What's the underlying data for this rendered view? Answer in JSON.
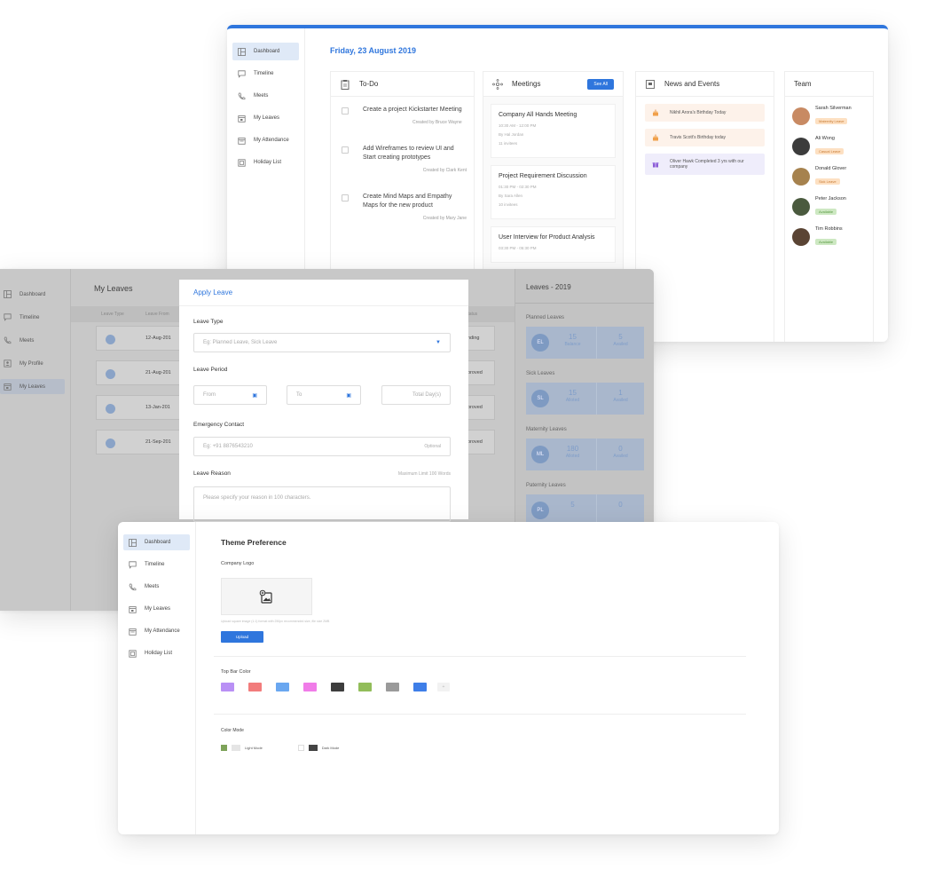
{
  "dashboard": {
    "nav": [
      {
        "label": "Dashboard",
        "icon": "dashboard-icon",
        "active": true
      },
      {
        "label": "Timeline",
        "icon": "chat-icon",
        "active": false
      },
      {
        "label": "Meets",
        "icon": "phone-icon",
        "active": false
      },
      {
        "label": "My Leaves",
        "icon": "calendar-icon",
        "active": false
      },
      {
        "label": "My Attendance",
        "icon": "calendar-check-icon",
        "active": false
      },
      {
        "label": "Holiday List",
        "icon": "holiday-icon",
        "active": false
      }
    ],
    "date": "Friday, 23 August 2019",
    "todo": {
      "title": "To-Do",
      "items": [
        {
          "text": "Create a project Kickstarter Meeting",
          "by": "Created by Bruce Wayne"
        },
        {
          "text": "Add Wireframes to review UI and Start creating prototypes",
          "by": "Created by Clark Kent"
        },
        {
          "text": "Create Mind Maps and Empathy Maps for the new product",
          "by": "Created by Mary Jane"
        }
      ]
    },
    "meetings": {
      "title": "Meetings",
      "see_all": "See All",
      "items": [
        {
          "title": "Company All Hands Meeting",
          "time": "10:30 AM - 12:00 PM",
          "by": "By Hal Jordan",
          "invitees": "11 invitees"
        },
        {
          "title": "Project Requirement Discussion",
          "time": "01:30 PM - 02:30 PM",
          "by": "By Sara Allen",
          "invitees": "10 invitees"
        },
        {
          "title": "User Interview for Product Analysis",
          "time": "03:30 PM - 05:30 PM",
          "by": "",
          "invitees": ""
        }
      ]
    },
    "news": {
      "title": "News and Events",
      "items": [
        {
          "text": "Nikhil Arora's Birthday Today",
          "color": "orange",
          "icon": "cake-icon"
        },
        {
          "text": "Travis Scott's Birthday today",
          "color": "orange",
          "icon": "cake-icon"
        },
        {
          "text": "Oliver Hawk Completed 3 yrs with our company",
          "color": "purple",
          "icon": "gift-icon"
        }
      ]
    },
    "team": {
      "title": "Team",
      "members": [
        {
          "name": "Sarah Silverman",
          "tag": "Maternity Leave",
          "tag_bg": "#fde0c2",
          "tag_fg": "#c77a33",
          "avatar": "#c88a63"
        },
        {
          "name": "Ali Wong",
          "tag": "Casual Leave",
          "tag_bg": "#fde0c2",
          "tag_fg": "#c77a33",
          "avatar": "#3c3c3c"
        },
        {
          "name": "Donald Glover",
          "tag": "Sick Leave",
          "tag_bg": "#fde0c2",
          "tag_fg": "#c77a33",
          "avatar": "#a6824e"
        },
        {
          "name": "Peter Jackson",
          "tag": "Available",
          "tag_bg": "#cde8c2",
          "tag_fg": "#5a9a43",
          "avatar": "#4a5a3e"
        },
        {
          "name": "Tim Robbins",
          "tag": "Available",
          "tag_bg": "#cde8c2",
          "tag_fg": "#5a9a43",
          "avatar": "#5a4434"
        }
      ]
    }
  },
  "leaves_page": {
    "nav": [
      {
        "label": "Dashboard",
        "icon": "dashboard-icon",
        "active": false
      },
      {
        "label": "Timeline",
        "icon": "chat-icon",
        "active": false
      },
      {
        "label": "Meets",
        "icon": "phone-icon",
        "active": false
      },
      {
        "label": "My Profile",
        "icon": "profile-icon",
        "active": false
      },
      {
        "label": "My Leaves",
        "icon": "calendar-icon",
        "active": true
      }
    ],
    "title": "My Leaves",
    "headers": [
      "Leave Type",
      "Leave From",
      "Status"
    ],
    "rows": [
      {
        "date": "12-Aug-201",
        "status": "nding"
      },
      {
        "date": "21-Aug-201",
        "status": "proved"
      },
      {
        "date": "13-Jan-201",
        "status": "proved"
      },
      {
        "date": "21-Sep-201",
        "status": "proved"
      }
    ],
    "summary": {
      "title": "Leaves - 2019",
      "sections": [
        {
          "label": "Planned Leaves",
          "code": "EL",
          "a_val": "15",
          "a_lbl": "Balance",
          "b_val": "5",
          "b_lbl": "Availed"
        },
        {
          "label": "Sick Leaves",
          "code": "SL",
          "a_val": "15",
          "a_lbl": "Alloted",
          "b_val": "1",
          "b_lbl": "Availed"
        },
        {
          "label": "Maternity Leaves",
          "code": "ML",
          "a_val": "180",
          "a_lbl": "Alloted",
          "b_val": "0",
          "b_lbl": "Availed"
        },
        {
          "label": "Paternity Leaves",
          "code": "PL",
          "a_val": "5",
          "a_lbl": "",
          "b_val": "0",
          "b_lbl": ""
        }
      ]
    },
    "modal": {
      "title": "Apply Leave",
      "leave_type_label": "Leave Type",
      "leave_type_placeholder": "Eg: Planned Leave, Sick Leave",
      "leave_period_label": "Leave Period",
      "from_placeholder": "From",
      "to_placeholder": "To",
      "total_placeholder": "Total Day(s)",
      "emergency_label": "Emergency Contact",
      "emergency_placeholder": "Eg: +91 8876543210",
      "optional": "Optional",
      "reason_label": "Leave Reason",
      "reason_limit": "Maximum Limit 100 Words",
      "reason_placeholder": "Please specify your reason in 100 characters."
    }
  },
  "theme_page": {
    "nav": [
      {
        "label": "Dashboard",
        "icon": "dashboard-icon",
        "active": true
      },
      {
        "label": "Timeline",
        "icon": "chat-icon",
        "active": false
      },
      {
        "label": "Meets",
        "icon": "phone-icon",
        "active": false
      },
      {
        "label": "My Leaves",
        "icon": "calendar-icon",
        "active": false
      },
      {
        "label": "My Attendance",
        "icon": "calendar-check-icon",
        "active": false
      },
      {
        "label": "Holiday List",
        "icon": "holiday-icon",
        "active": false
      }
    ],
    "title": "Theme Preference",
    "logo_label": "Company Logo",
    "hint": "Upload square image (1:1) format with 250px recommended size, file size 2MB",
    "upload": "Upload",
    "top_bar_label": "Top Bar Color",
    "colors": [
      "#b990f5",
      "#f27c7c",
      "#6aa7f0",
      "#f07ce8",
      "#3d3d3d",
      "#92bd5a",
      "#9a9a9a",
      "#3e7ee8"
    ],
    "more": "+",
    "color_mode_label": "Color Mode",
    "light_mode": "Light Mode",
    "dark_mode": "Dark Mode"
  }
}
